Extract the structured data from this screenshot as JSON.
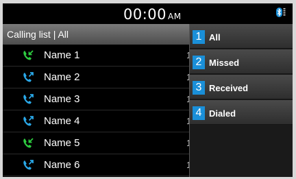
{
  "status_bar": {
    "time": "00:00",
    "ampm": "AM",
    "bluetooth_icon": "bluetooth-icon"
  },
  "list_header": {
    "title": "Calling list | All"
  },
  "calls": [
    {
      "name": "Name 1",
      "time_partial": "1",
      "type": "received",
      "icon": "phone-incoming-icon",
      "color": "#2ecc40"
    },
    {
      "name": "Name 2",
      "time_partial": "1",
      "type": "dialed",
      "icon": "phone-outgoing-icon",
      "color": "#2aa8e8"
    },
    {
      "name": "Name 3",
      "time_partial": "1",
      "type": "dialed",
      "icon": "phone-outgoing-icon",
      "color": "#2aa8e8"
    },
    {
      "name": "Name 4",
      "time_partial": "1",
      "type": "dialed",
      "icon": "phone-outgoing-icon",
      "color": "#2aa8e8"
    },
    {
      "name": "Name 5",
      "time_partial": "1",
      "type": "received",
      "icon": "phone-incoming-icon",
      "color": "#2ecc40"
    },
    {
      "name": "Name 6",
      "time_partial": "1",
      "type": "dialed",
      "icon": "phone-outgoing-icon",
      "color": "#2aa8e8"
    }
  ],
  "filter_menu": {
    "items": [
      {
        "number": "1",
        "label": "All"
      },
      {
        "number": "2",
        "label": "Missed"
      },
      {
        "number": "3",
        "label": "Received"
      },
      {
        "number": "4",
        "label": "Dialed"
      }
    ]
  },
  "colors": {
    "accent": "#1a8fd8",
    "received": "#2ecc40",
    "dialed": "#2aa8e8"
  }
}
